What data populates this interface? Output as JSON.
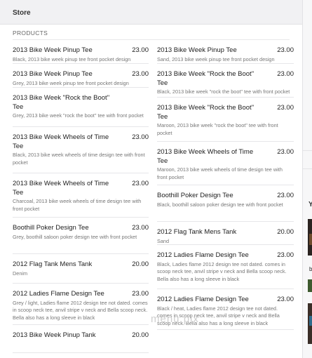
{
  "store": {
    "title": "Store"
  },
  "section": {
    "title": "PRODUCTS"
  },
  "watermark": "menu pix",
  "sidebar_partial": {
    "letter": "Y",
    "letter2": "b"
  },
  "products_left": [
    {
      "name": "2013 Bike Week Pinup Tee",
      "price": "23.00",
      "desc": "Black, 2013 bike week pinup tee front pocket design"
    },
    {
      "name": "2013 Bike Week Pinup Tee",
      "price": "23.00",
      "desc": "Grey, 2013 bike week pinup tee front pocket design"
    },
    {
      "name": "2013 Bike Week \"Rock the Boot\" Tee",
      "price": "",
      "desc": "Grey, 2013 bike week \"rock the boot\" tee with front pocket"
    },
    {
      "name": "2013 Bike Week Wheels of Time Tee",
      "price": "23.00",
      "desc": "Black, 2013 bike week wheels of time design tee with front pocket"
    },
    {
      "name": "2013 Bike Week Wheels of Time Tee",
      "price": "23.00",
      "desc": "Charcoal, 2013 bike week wheels of time design tee with front pocket"
    },
    {
      "name": "Boothill Poker Design Tee",
      "price": "23.00",
      "desc": "Grey, boothill saloon poker design tee with front pocket"
    },
    {
      "name": "2012 Flag Tank Mens Tank",
      "price": "20.00",
      "desc": "Denim"
    },
    {
      "name": "2012 Ladies Flame Design Tee",
      "price": "23.00",
      "desc": "Grey / light, Ladies flame 2012 design tee not dated. comes in scoop neck tee, anvil stripe v neck and Bella scoop neck. Bella also has a long sleeve in black"
    },
    {
      "name": "2013 Bike Week Pinup Tank",
      "price": "20.00",
      "desc": ""
    }
  ],
  "products_right": [
    {
      "name": "2013 Bike Week Pinup Tee",
      "price": "23.00",
      "desc": "Sand, 2013 bike week pinup tee front pocket design"
    },
    {
      "name": "2013 Bike Week \"Rock the Boot\" Tee",
      "price": "23.00",
      "desc": "Black, 2013 bike week \"rock the boot\" tee with front pocket"
    },
    {
      "name": "2013 Bike Week \"Rock the Boot\" Tee",
      "price": "23.00",
      "desc": "Maroon, 2013 bike week \"rock the boot\" tee with front pocket"
    },
    {
      "name": "2013 Bike Week Wheels of Time Tee",
      "price": "23.00",
      "desc": "Maroon, 2013 bike week wheels of time design tee with front pocket"
    },
    {
      "name": "Boothill Poker Design Tee",
      "price": "23.00",
      "desc": "Black, boothill saloon poker design tee with front pocket"
    },
    {
      "name": "2012 Flag Tank Mens Tank",
      "price": "20.00",
      "desc": "Sand"
    },
    {
      "name": "2012 Ladies Flame Design Tee",
      "price": "23.00",
      "desc": "Black, Ladies flame 2012 design tee not dated. comes in scoop neck tee, anvil stripe v neck and Bella scoop neck. Bella also has a long sleeve in black"
    },
    {
      "name": "2012 Ladies Flame Design Tee",
      "price": "23.00",
      "desc": "Black / heat, Ladies flame 2012 design tee not dated. comes in scoop neck tee, anvil stripe v neck and Bella scoop neck. Bella also has a long sleeve in black"
    }
  ]
}
